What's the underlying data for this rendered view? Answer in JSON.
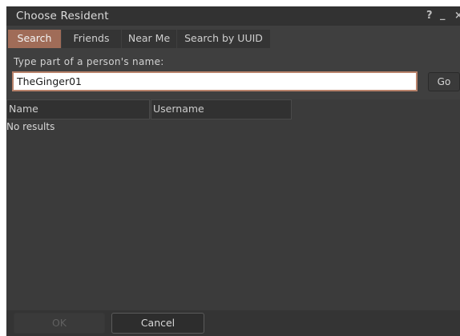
{
  "window": {
    "title": "Choose Resident",
    "help_glyph": "?",
    "minimize_glyph": "_",
    "close_glyph": "×"
  },
  "tabs": [
    {
      "label": "Search",
      "active": true
    },
    {
      "label": "Friends",
      "active": false
    },
    {
      "label": "Near Me",
      "active": false
    },
    {
      "label": "Search by UUID",
      "active": false
    }
  ],
  "search": {
    "label": "Type part of a person's name:",
    "value": "TheGinger01",
    "go_label": "Go"
  },
  "results": {
    "columns": [
      "Name",
      "Username"
    ],
    "empty_text": "No results"
  },
  "footer": {
    "ok_label": "OK",
    "ok_enabled": false,
    "cancel_label": "Cancel"
  },
  "colors": {
    "active_tab": "#a06c58",
    "input_border": "#b8826a",
    "panel_background": "#3f3f3f"
  }
}
